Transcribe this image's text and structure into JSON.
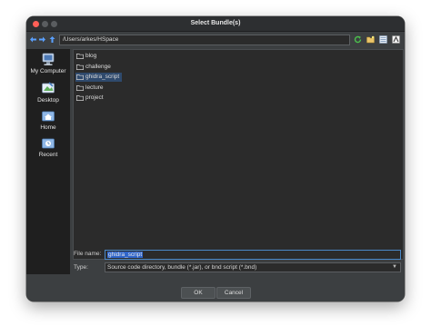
{
  "window": {
    "title": "Select Bundle(s)"
  },
  "toolbar": {
    "back_icon": "arrow-left-icon",
    "forward_icon": "arrow-right-icon",
    "up_icon": "arrow-up-icon",
    "path": "/Users/arkes/HSpace"
  },
  "places": [
    {
      "label": "My Computer",
      "icon": "computer-icon"
    },
    {
      "label": "Desktop",
      "icon": "desktop-icon"
    },
    {
      "label": "Home",
      "icon": "home-icon"
    },
    {
      "label": "Recent",
      "icon": "recent-icon"
    }
  ],
  "files": [
    {
      "name": "blog",
      "selected": false
    },
    {
      "name": "challenge",
      "selected": false
    },
    {
      "name": "ghidra_script",
      "selected": true
    },
    {
      "name": "lecture",
      "selected": false
    },
    {
      "name": "project",
      "selected": false
    }
  ],
  "filename": {
    "label": "File name:",
    "value": "ghidra_script"
  },
  "filetype": {
    "label": "Type:",
    "value": "Source code directory, bundle (*.jar), or bnd script (*.bnd)"
  },
  "buttons": {
    "ok": "OK",
    "cancel": "Cancel"
  },
  "colors": {
    "accent": "#4a88c7",
    "selection": "#2f4a6d",
    "window_bg": "#3c3f41",
    "panel_bg": "#2b2b2b"
  }
}
